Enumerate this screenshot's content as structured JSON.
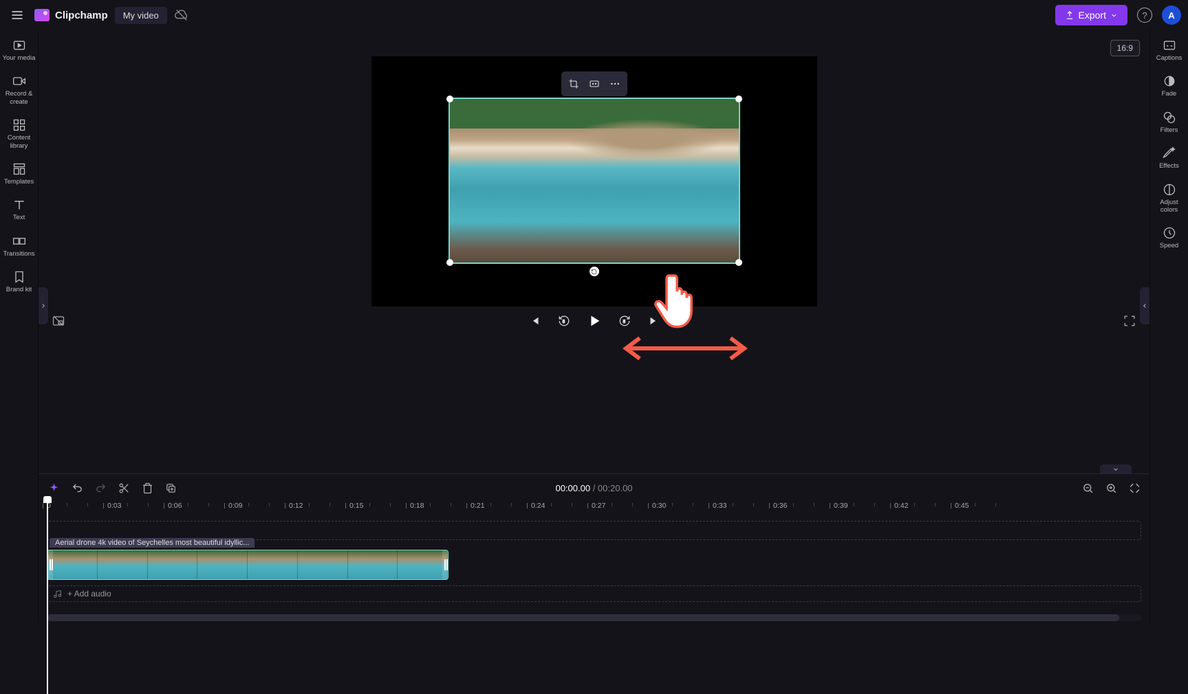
{
  "app": {
    "name": "Clipchamp",
    "project_title": "My video"
  },
  "export_label": "Export",
  "avatar_letter": "A",
  "aspect_ratio": "16:9",
  "left_rail": [
    {
      "label": "Your media"
    },
    {
      "label": "Record & create"
    },
    {
      "label": "Content library"
    },
    {
      "label": "Templates"
    },
    {
      "label": "Text"
    },
    {
      "label": "Transitions"
    },
    {
      "label": "Brand kit"
    }
  ],
  "right_rail": [
    {
      "label": "Captions"
    },
    {
      "label": "Fade"
    },
    {
      "label": "Filters"
    },
    {
      "label": "Effects"
    },
    {
      "label": "Adjust colors"
    },
    {
      "label": "Speed"
    }
  ],
  "playback": {
    "current": "00:00.00",
    "duration": "00:20.00"
  },
  "ruler_ticks": [
    "0",
    "0:03",
    "0:06",
    "0:09",
    "0:12",
    "0:15",
    "0:18",
    "0:21",
    "0:24",
    "0:27",
    "0:30",
    "0:33",
    "0:36",
    "0:39",
    "0:42",
    "0:45"
  ],
  "clip_title": "Aerial drone 4k video of Seychelles most beautiful idyllic...",
  "add_audio_label": "+ Add audio"
}
